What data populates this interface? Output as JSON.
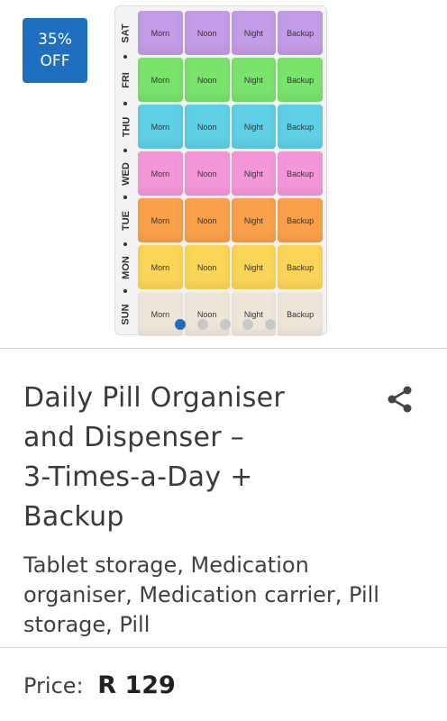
{
  "badge": {
    "line1": "35%",
    "line2": "OFF"
  },
  "organiser": {
    "slots": [
      "Morn",
      "Noon",
      "Night",
      "Backup"
    ],
    "days": [
      {
        "label": "SAT",
        "color": "#c39be6"
      },
      {
        "label": "FRI",
        "color": "#79e36b"
      },
      {
        "label": "THU",
        "color": "#5fcfe6"
      },
      {
        "label": "WED",
        "color": "#f497d9"
      },
      {
        "label": "TUE",
        "color": "#f9a04a"
      },
      {
        "label": "MON",
        "color": "#fbd558"
      },
      {
        "label": "SUN",
        "color": "#efe6da"
      }
    ]
  },
  "gallery": {
    "dots": 5,
    "active_index": 0
  },
  "product": {
    "title": "Daily Pill Organiser and Dispenser – 3-Times-a-Day + Backup",
    "title_lines": [
      "Daily Pill Organiser",
      "and Dispenser –",
      "3-Times-a-Day +",
      "Backup"
    ],
    "description": "Tablet storage, Medication organiser, Medication carrier, Pill storage, Pill",
    "price_label": "Price:",
    "price_value": "R 129"
  },
  "icons": {
    "share": "share-icon"
  }
}
